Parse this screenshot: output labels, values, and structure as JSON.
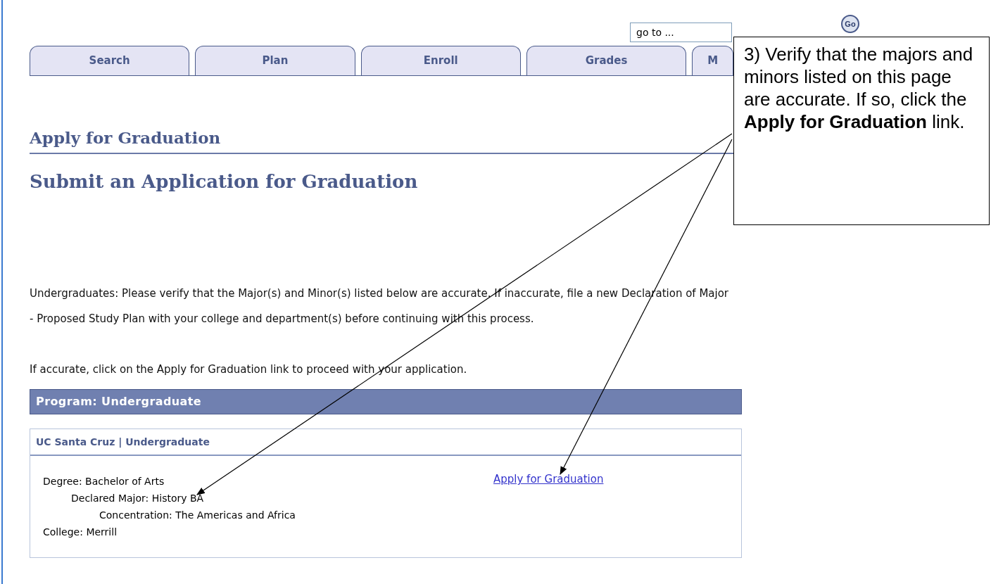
{
  "goto": {
    "value": "go to ...",
    "button": "Go"
  },
  "tabs": [
    {
      "label": "Search",
      "selected": false
    },
    {
      "label": "Plan",
      "selected": false
    },
    {
      "label": "Enroll",
      "selected": false
    },
    {
      "label": "Grades",
      "selected": false
    },
    {
      "label": "M",
      "selected": false
    }
  ],
  "page_title": "Apply for Graduation",
  "subtitle": "Submit an Application for Graduation",
  "paragraphs": [
    "Undergraduates: Please verify that the Major(s) and Minor(s) listed below are accurate. If inaccurate, file a new Declaration of Major - Proposed Study Plan with your college and department(s) before continuing with this process.",
    "If accurate, click on the Apply for Graduation link to proceed with your application."
  ],
  "program": {
    "header": "Program: Undergraduate",
    "card_title": "UC Santa Cruz | Undergraduate",
    "details": [
      {
        "text": "Degree: Bachelor of Arts",
        "children": [
          {
            "text": "Declared Major: History BA",
            "children": [
              {
                "text": "Concentration: The Americas and Africa"
              }
            ]
          }
        ]
      },
      {
        "text": "College: Merrill"
      }
    ],
    "link": "Apply for Graduation"
  },
  "callout": {
    "text": "3) Verify that the majors and minors listed on this page are accurate. If so, click the **Apply for Graduation** link."
  }
}
